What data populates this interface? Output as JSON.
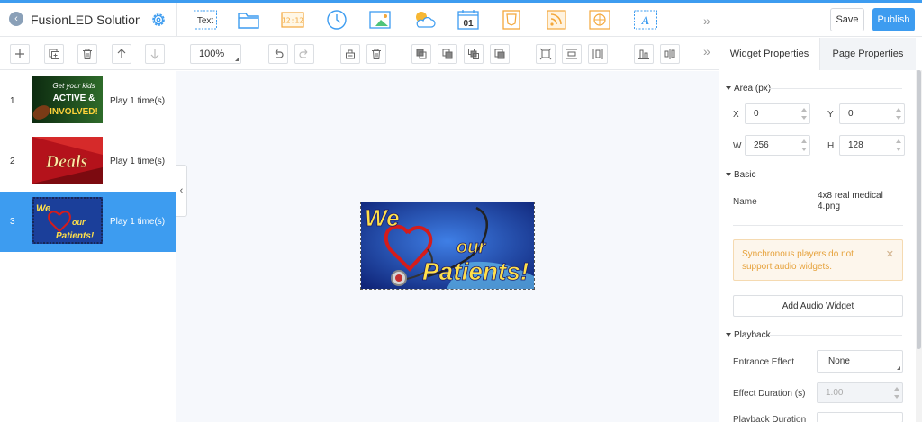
{
  "header": {
    "title": "FusionLED Solution De...",
    "save_label": "Save",
    "publish_label": "Publish",
    "widgets": [
      {
        "name": "text-widget-icon",
        "label": "Text"
      },
      {
        "name": "folder-widget-icon"
      },
      {
        "name": "digital-clock-widget-icon",
        "label": "12:12"
      },
      {
        "name": "analog-clock-widget-icon"
      },
      {
        "name": "image-widget-icon"
      },
      {
        "name": "weather-widget-icon"
      },
      {
        "name": "countdown-widget-icon",
        "label": "01"
      },
      {
        "name": "html5-widget-icon"
      },
      {
        "name": "rss-widget-icon"
      },
      {
        "name": "webpage-widget-icon"
      },
      {
        "name": "font-text-widget-icon",
        "label": "A"
      }
    ]
  },
  "toolbar": {
    "zoom": "100%"
  },
  "playlist": {
    "items": [
      {
        "num": "1",
        "label": "Play 1 time(s)",
        "thumb_text": [
          "Get your kids",
          "ACTIVE &",
          "INVOLVED!"
        ]
      },
      {
        "num": "2",
        "label": "Play 1 time(s)",
        "thumb_text": [
          "Deals"
        ]
      },
      {
        "num": "3",
        "label": "Play 1 time(s)",
        "thumb_text": [
          "We",
          "our",
          "Patients!"
        ]
      }
    ]
  },
  "canvas": {
    "widget_text": [
      "We",
      "our",
      "Patients!"
    ]
  },
  "panel": {
    "tabs": [
      "Widget Properties",
      "Page Properties"
    ],
    "area": {
      "title": "Area (px)",
      "x_label": "X",
      "x": "0",
      "y_label": "Y",
      "y": "0",
      "w_label": "W",
      "w": "256",
      "h_label": "H",
      "h": "128"
    },
    "basic": {
      "title": "Basic",
      "name_label": "Name",
      "name_value": "4x8 real medical 4.png"
    },
    "warning": "Synchronous players do not support audio widgets.",
    "add_audio_label": "Add Audio Widget",
    "playback": {
      "title": "Playback",
      "entrance_label": "Entrance Effect",
      "entrance_value": "None",
      "duration_label": "Effect Duration (s)",
      "duration_value": "1.00",
      "playback_duration_label": "Playback Duration"
    }
  },
  "colors": {
    "accent": "#3d9cf0",
    "warning_bg": "#fdf6ec",
    "warning_text": "#e6a23c"
  }
}
